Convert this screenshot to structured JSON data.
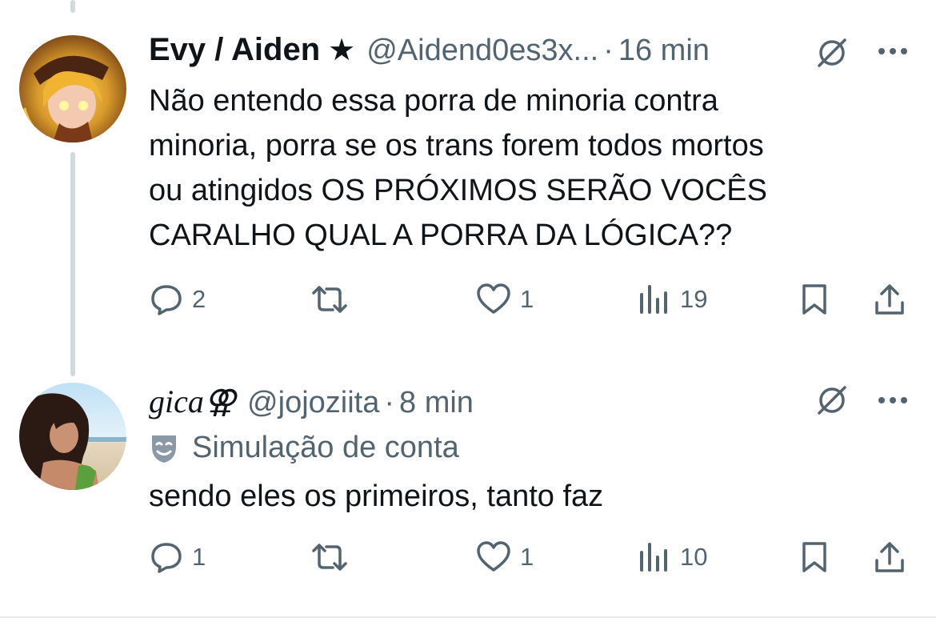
{
  "tweets": [
    {
      "author_name": "Evy / Aiden",
      "verified_glyph": "★",
      "handle": "@Aidend0es3x...",
      "separator": "·",
      "time": "16 min",
      "text_lines": [
        "Não entendo essa porra de minoria contra",
        "minoria, porra se os trans forem todos mortos",
        "ou atingidos OS PRÓXIMOS SERÃO VOCÊS",
        "CARALHO QUAL A PORRA DA LÓGICA??"
      ],
      "replies": "2",
      "likes": "1",
      "views": "19"
    },
    {
      "author_name": "gica⚢",
      "handle": "@jojoziita",
      "separator": "·",
      "time": "8 min",
      "account_label": "Simulação de conta",
      "text_lines": [
        "sendo eles os primeiros, tanto faz"
      ],
      "replies": "1",
      "likes": "1",
      "views": "10"
    }
  ],
  "icons": {
    "reply": "reply-icon",
    "retweet": "retweet-icon",
    "like": "heart-icon",
    "views": "views-icon",
    "bookmark": "bookmark-icon",
    "share": "share-icon",
    "grok": "grok-icon",
    "more": "more-icon",
    "parody": "theater-mask-icon"
  },
  "colors": {
    "text": "#0f1419",
    "secondary": "#536471",
    "thread_line": "#cfd9de"
  }
}
